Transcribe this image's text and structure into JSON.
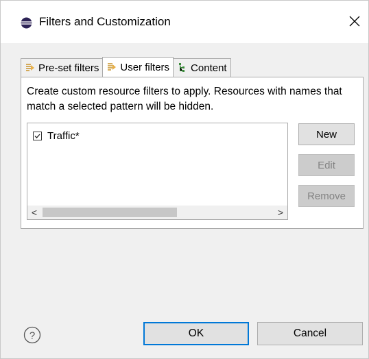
{
  "window": {
    "title": "Filters and Customization",
    "close_icon": "close-icon"
  },
  "tabs": [
    {
      "label": "Pre-set filters",
      "icon": "filter-icon",
      "active": false
    },
    {
      "label": "User filters",
      "icon": "filter-icon",
      "active": true
    },
    {
      "label": "Content",
      "icon": "content-tree-icon",
      "active": false
    }
  ],
  "user_filters": {
    "description": "Create custom resource filters to apply. Resources with names that match a selected pattern will be hidden.",
    "items": [
      {
        "label": "Traffic*",
        "checked": true
      }
    ],
    "buttons": {
      "new": "New",
      "edit": "Edit",
      "remove": "Remove"
    },
    "scroll_left": "<",
    "scroll_right": ">"
  },
  "footer": {
    "help_icon": "help-icon",
    "ok": "OK",
    "cancel": "Cancel"
  },
  "colors": {
    "accent": "#0078d7",
    "dialog_bg": "#f0f0f0",
    "disabled_text": "#838383"
  }
}
